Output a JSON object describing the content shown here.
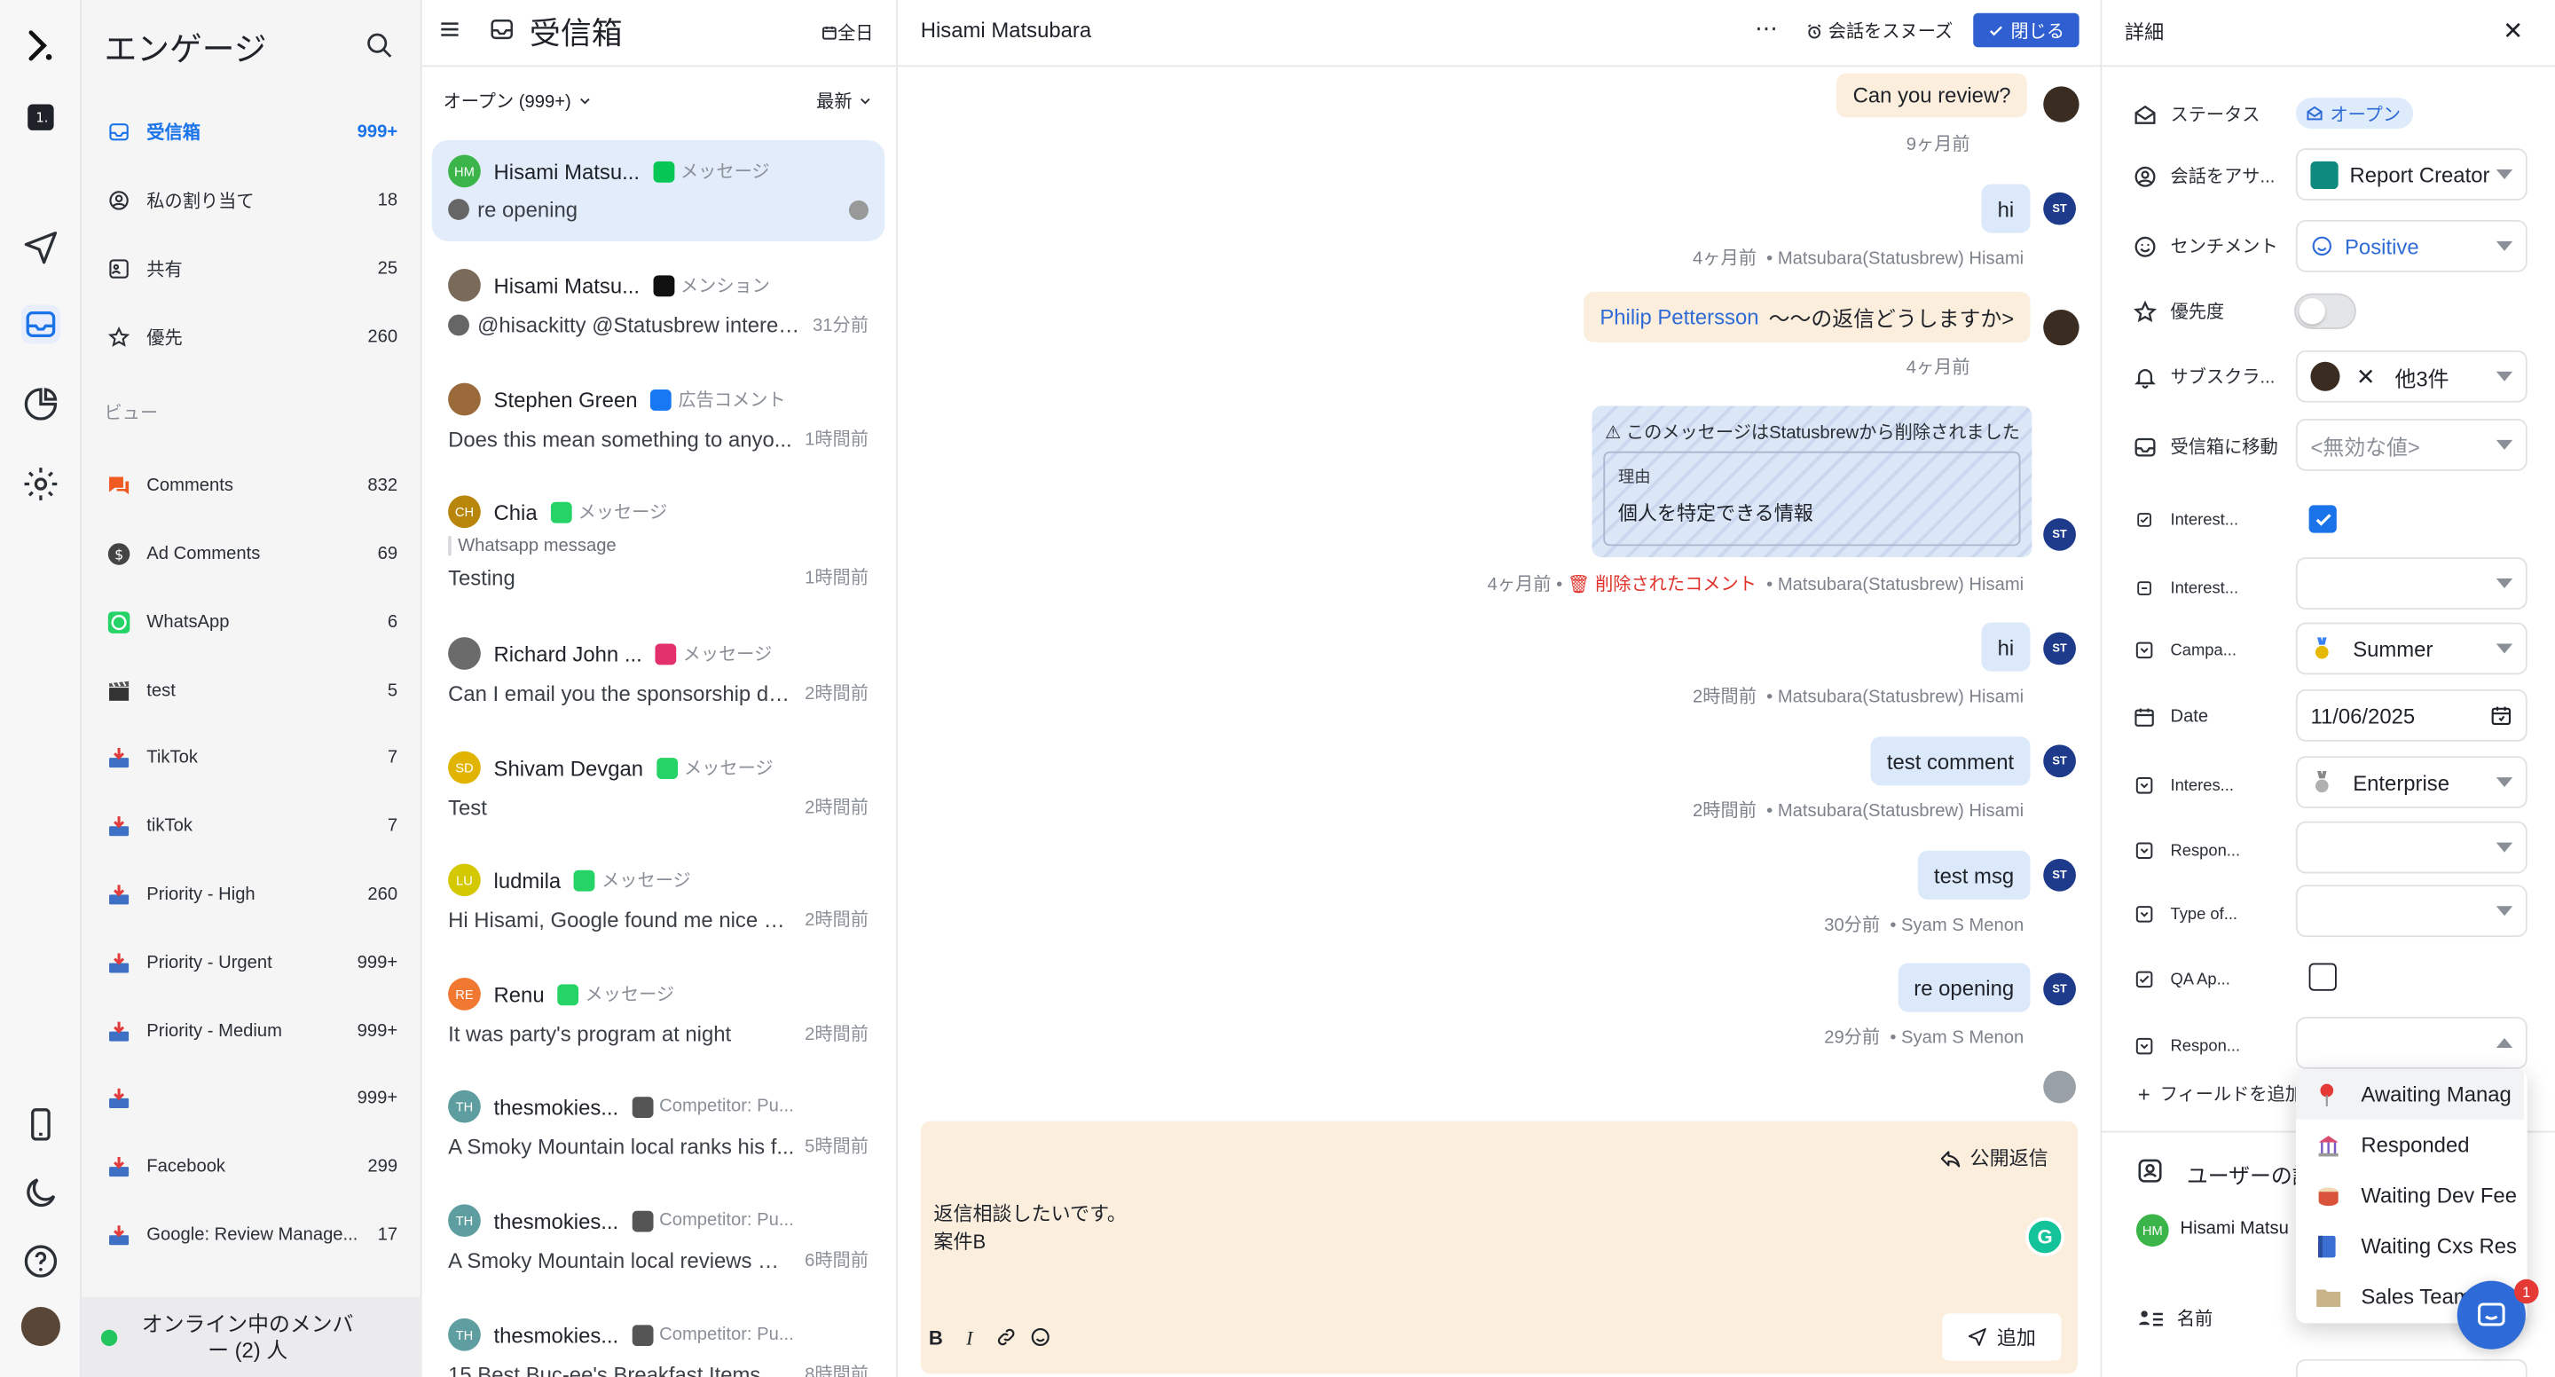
{
  "nav": {
    "title": "エンゲージ",
    "items": [
      {
        "label": "受信箱",
        "count": "999+",
        "icon": "inbox-icon"
      },
      {
        "label": "私の割り当て",
        "count": "18",
        "icon": "user-circle-icon"
      },
      {
        "label": "共有",
        "count": "25",
        "icon": "shared-icon"
      },
      {
        "label": "優先",
        "count": "260",
        "icon": "star-icon"
      }
    ],
    "views_heading": "ビュー",
    "views": [
      {
        "label": "Comments",
        "count": "832",
        "icon": "comments-icon"
      },
      {
        "label": "Ad Comments",
        "count": "69",
        "icon": "dollar-icon"
      },
      {
        "label": "WhatsApp",
        "count": "6",
        "icon": "whatsapp-icon"
      },
      {
        "label": "test",
        "count": "5",
        "icon": "clapper-icon"
      },
      {
        "label": "TikTok",
        "count": "7",
        "icon": "inbox-tray-icon"
      },
      {
        "label": "tikTok",
        "count": "7",
        "icon": "inbox-tray-icon"
      },
      {
        "label": "Priority - High",
        "count": "260",
        "icon": "inbox-tray-icon"
      },
      {
        "label": "Priority - Urgent",
        "count": "999+",
        "icon": "inbox-tray-icon"
      },
      {
        "label": "Priority - Medium",
        "count": "999+",
        "icon": "inbox-tray-icon"
      },
      {
        "label": "",
        "count": "999+",
        "icon": "inbox-tray-icon"
      },
      {
        "label": "Facebook",
        "count": "299",
        "icon": "inbox-tray-icon"
      },
      {
        "label": "Google: Review Manage...",
        "count": "17",
        "icon": "inbox-tray-icon"
      }
    ],
    "online": "オンライン中のメンバー (2) 人"
  },
  "list": {
    "title": "受信箱",
    "all_label": "全日",
    "filter": "オープン (999+)",
    "sort": "最新",
    "conversations": [
      {
        "initials": "HM",
        "avatar_color": "#3bb54a",
        "name": "Hisami Matsu...",
        "channel": "メッセージ",
        "channel_color": "#06c755",
        "text": "re opening",
        "time": ""
      },
      {
        "initials": "",
        "avatar_color": "#7a6a5a",
        "name": "Hisami Matsu...",
        "channel": "メンション",
        "channel_color": "#111111",
        "text": "@hisackitty @Statusbrew interes...",
        "time": "31分前"
      },
      {
        "initials": "",
        "avatar_color": "#9a6a3a",
        "name": "Stephen Green",
        "channel": "広告コメント",
        "channel_color": "#1877f2",
        "text": "Does this mean something to anyo...",
        "time": "1時間前"
      },
      {
        "initials": "CH",
        "avatar_color": "#b8860b",
        "name": "Chia",
        "channel": "メッセージ",
        "channel_color": "#25d366",
        "sub": "Whatsapp message",
        "text": "Testing",
        "time": "1時間前"
      },
      {
        "initials": "",
        "avatar_color": "#6b6b6b",
        "name": "Richard John ...",
        "channel": "メッセージ",
        "channel_color": "#e1306c",
        "text": "Can I email you the sponsorship de...",
        "time": "2時間前"
      },
      {
        "initials": "SD",
        "avatar_color": "#e0b400",
        "name": "Shivam Devgan",
        "channel": "メッセージ",
        "channel_color": "#25d366",
        "text": "Test",
        "time": "2時間前"
      },
      {
        "initials": "LU",
        "avatar_color": "#d4c800",
        "name": "ludmila",
        "channel": "メッセージ",
        "channel_color": "#25d366",
        "text": "Hi Hisami, Google found me nice m...",
        "time": "2時間前"
      },
      {
        "initials": "RE",
        "avatar_color": "#f07830",
        "name": "Renu",
        "channel": "メッセージ",
        "channel_color": "#25d366",
        "text": "It was party's program at night",
        "time": "2時間前"
      },
      {
        "initials": "TH",
        "avatar_color": "#5f9ea0",
        "name": "thesmokies...",
        "channel": "Competitor: Pu...",
        "channel_color": "#555555",
        "text": "A Smoky Mountain local ranks his f...",
        "time": "5時間前"
      },
      {
        "initials": "TH",
        "avatar_color": "#5f9ea0",
        "name": "thesmokies...",
        "channel": "Competitor: Pu...",
        "channel_color": "#555555",
        "text": "A Smoky Mountain local reviews Ol...",
        "time": "6時間前"
      },
      {
        "initials": "TH",
        "avatar_color": "#5f9ea0",
        "name": "thesmokies...",
        "channel": "Competitor: Pu...",
        "channel_color": "#555555",
        "text": "15 Best Buc-ee's Breakfast Items ...",
        "time": "8時間前"
      }
    ]
  },
  "chat": {
    "contact_name": "Hisami Matsubara",
    "snooze": "会話をスヌーズ",
    "close": "閉じる",
    "messages": [
      {
        "text": "Can you review?",
        "meta": "9ヶ月前"
      },
      {
        "text": "hi",
        "time": "4ヶ月前",
        "author": "Matsubara(Statusbrew) Hisami"
      },
      {
        "mention": "Philip Pettersson",
        "text": "〜〜の返信どうしますか>",
        "meta": "4ヶ月前"
      },
      {
        "deleted_notice": "このメッセージはStatusbrewから削除されました",
        "reason_label": "理由",
        "reason": "個人を特定できる情報",
        "time": "4ヶ月前",
        "deleted_label": "削除されたコメント",
        "author": "Matsubara(Statusbrew) Hisami"
      },
      {
        "text": "hi",
        "time": "2時間前",
        "author": "Matsubara(Statusbrew) Hisami"
      },
      {
        "text": "test comment",
        "time": "2時間前",
        "author": "Matsubara(Statusbrew) Hisami"
      },
      {
        "text": "test msg",
        "time": "30分前",
        "author": "Syam S Menon"
      },
      {
        "text": "re opening",
        "time": "29分前",
        "author": "Syam S Menon"
      }
    ],
    "reply_mode": "公開返信",
    "composer_line1": "返信相談したいです。",
    "composer_line2": "案件B",
    "send": "追加"
  },
  "details": {
    "title": "詳細",
    "status_label": "ステータス",
    "status_value": "オープン",
    "assign_label": "会話をアサ...",
    "assign_value": "Report Creator",
    "sentiment_label": "センチメント",
    "sentiment_value": "Positive",
    "priority_label": "優先度",
    "subscribers_label": "サブスクラ...",
    "subscribers_more": "他3件",
    "move_label": "受信箱に移動",
    "move_placeholder": "<無効な値>",
    "interest1_label": "Interest...",
    "interest2_label": "Interest...",
    "campaign_label": "Campa...",
    "campaign_value": "Summer",
    "date_label": "Date",
    "date_value": "11/06/2025",
    "interes3_label": "Interes...",
    "interes3_value": "Enterprise",
    "respon1_label": "Respon...",
    "type_label": "Type of...",
    "qa_label": "QA Ap...",
    "respon2_label": "Respon...",
    "add_field": "フィールドを追加",
    "user_section": "ユーザーの詳",
    "user_name": "Hisami Matsu",
    "name_label": "名前",
    "dropdown": [
      "Awaiting Manag",
      "Responded",
      "Waiting Dev Fee",
      "Waiting Cxs Res",
      "Sales Team"
    ],
    "notif_count": "1"
  }
}
